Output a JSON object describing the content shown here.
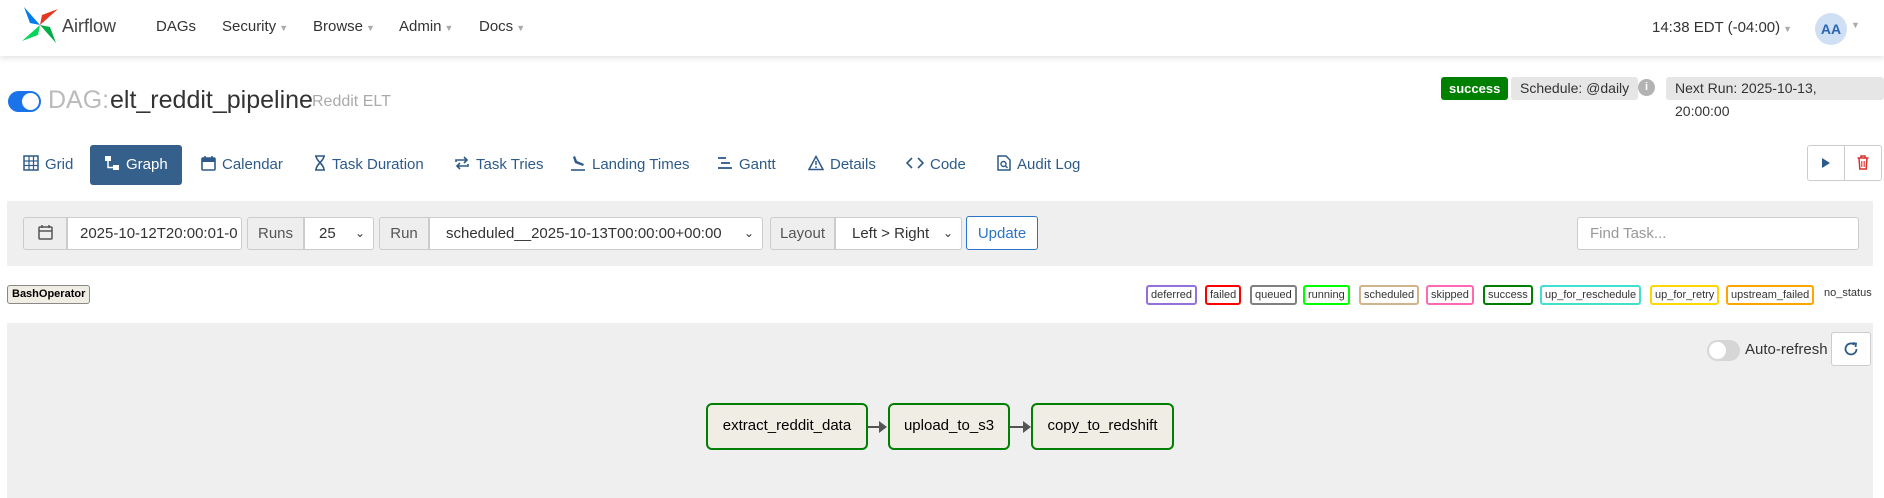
{
  "nav": {
    "brand": "Airflow",
    "items": [
      {
        "label": "DAGs",
        "has_dropdown": false
      },
      {
        "label": "Security",
        "has_dropdown": true
      },
      {
        "label": "Browse",
        "has_dropdown": true
      },
      {
        "label": "Admin",
        "has_dropdown": true
      },
      {
        "label": "Docs",
        "has_dropdown": true
      }
    ],
    "time": "14:38 EDT (-04:00)",
    "avatar": "AA"
  },
  "dag": {
    "prefix": "DAG:",
    "id": "elt_reddit_pipeline",
    "description": "Reddit ELT",
    "paused": false,
    "status": "success",
    "schedule": "Schedule: @daily",
    "next_run": "Next Run: 2025-10-13, 20:00:00"
  },
  "tabs": [
    {
      "label": "Grid",
      "icon": "grid-icon",
      "active": false
    },
    {
      "label": "Graph",
      "icon": "graph-icon",
      "active": true
    },
    {
      "label": "Calendar",
      "icon": "calendar-icon",
      "active": false
    },
    {
      "label": "Task Duration",
      "icon": "hourglass-icon",
      "active": false
    },
    {
      "label": "Task Tries",
      "icon": "repeat-icon",
      "active": false
    },
    {
      "label": "Landing Times",
      "icon": "plane-landing-icon",
      "active": false
    },
    {
      "label": "Gantt",
      "icon": "gantt-icon",
      "active": false
    },
    {
      "label": "Details",
      "icon": "warning-triangle-icon",
      "active": false
    },
    {
      "label": "Code",
      "icon": "code-icon",
      "active": false
    },
    {
      "label": "Audit Log",
      "icon": "file-search-icon",
      "active": false
    }
  ],
  "filters": {
    "base_date": "2025-10-12T20:00:01-0",
    "runs_label": "Runs",
    "runs_value": "25",
    "run_label": "Run",
    "run_value": "scheduled__2025-10-13T00:00:00+00:00",
    "layout_label": "Layout",
    "layout_value": "Left > Right",
    "update_label": "Update",
    "find_placeholder": "Find Task..."
  },
  "operator": "BashOperator",
  "legend": [
    {
      "label": "deferred",
      "color": "#9370db"
    },
    {
      "label": "failed",
      "color": "#ff0000"
    },
    {
      "label": "queued",
      "color": "#808080"
    },
    {
      "label": "running",
      "color": "#00ff00"
    },
    {
      "label": "scheduled",
      "color": "#d2b48c"
    },
    {
      "label": "skipped",
      "color": "#ff69b4"
    },
    {
      "label": "success",
      "color": "#008000"
    },
    {
      "label": "up_for_reschedule",
      "color": "#40e0d0"
    },
    {
      "label": "up_for_retry",
      "color": "#ffd700"
    },
    {
      "label": "upstream_failed",
      "color": "#ffa500"
    },
    {
      "label": "no_status",
      "color": ""
    }
  ],
  "graph": {
    "auto_refresh_label": "Auto-refresh",
    "auto_refresh": false,
    "tasks": [
      "extract_reddit_data",
      "upload_to_s3",
      "copy_to_redshift"
    ],
    "task_state_color": "#008000"
  }
}
